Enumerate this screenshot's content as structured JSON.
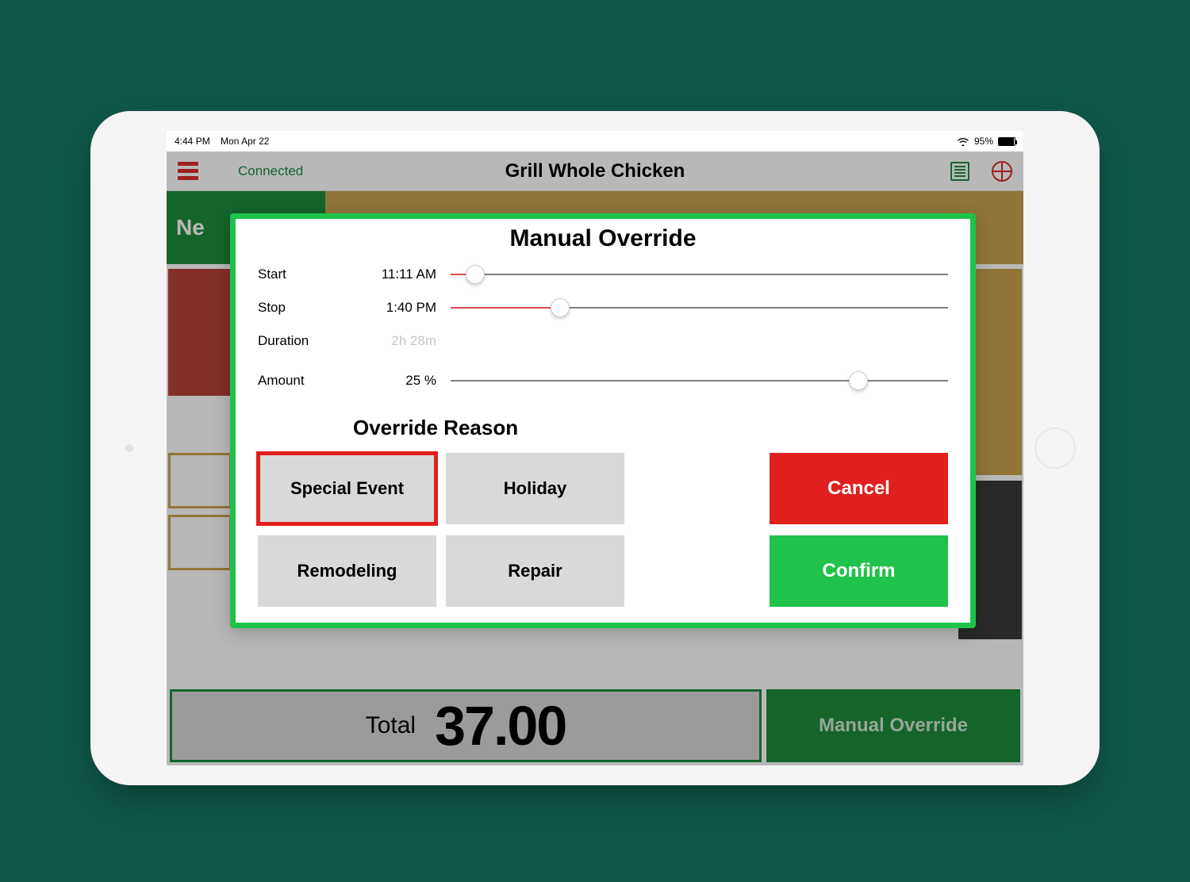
{
  "statusbar": {
    "time": "4:44 PM",
    "date": "Mon Apr 22",
    "battery_pct": "95%"
  },
  "header": {
    "connection": "Connected",
    "title": "Grill Whole Chicken"
  },
  "background": {
    "left_tab_prefix": "Ne",
    "total_label": "Total",
    "total_value": "37.00",
    "manual_override_btn": "Manual Override"
  },
  "modal": {
    "title": "Manual Override",
    "rows": {
      "start": {
        "label": "Start",
        "value": "11:11 AM",
        "pct": 5
      },
      "stop": {
        "label": "Stop",
        "value": "1:40 PM",
        "pct": 22
      },
      "duration": {
        "label": "Duration",
        "value": "2h 28m"
      },
      "amount": {
        "label": "Amount",
        "value": "25 %",
        "pct": 82
      }
    },
    "reason_title": "Override Reason",
    "reasons": {
      "special_event": "Special Event",
      "holiday": "Holiday",
      "remodeling": "Remodeling",
      "repair": "Repair"
    },
    "cancel": "Cancel",
    "confirm": "Confirm",
    "selected_reason": "special_event"
  }
}
